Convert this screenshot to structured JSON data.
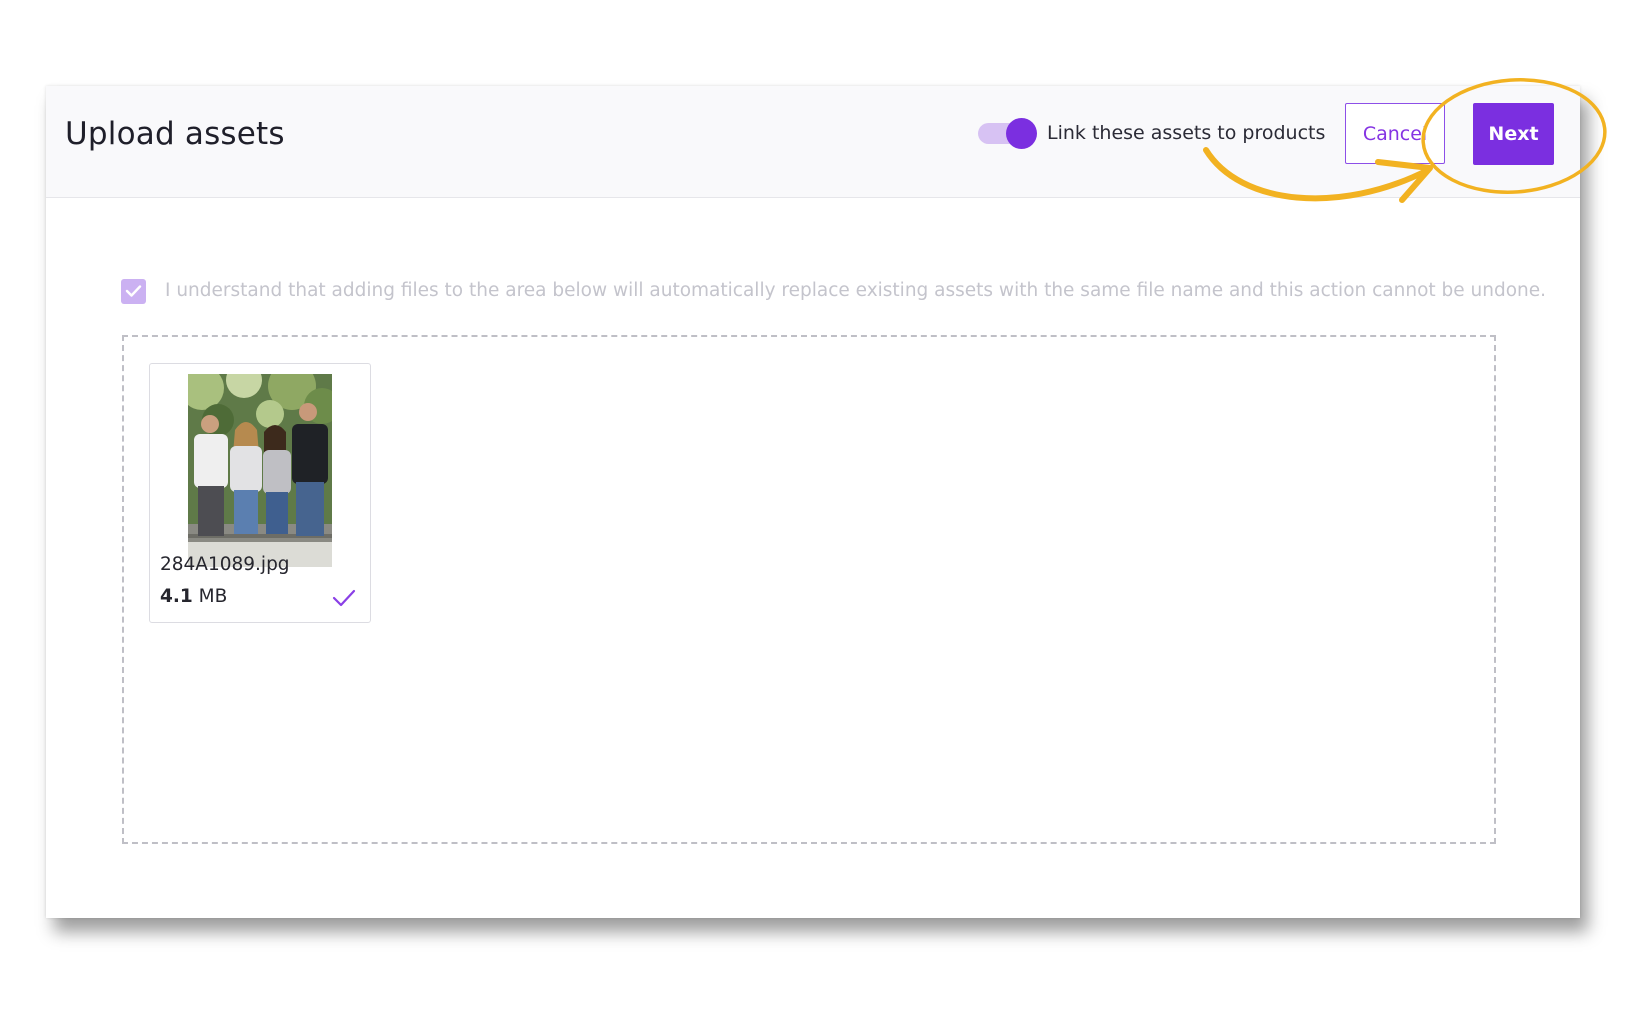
{
  "header": {
    "title": "Upload assets",
    "link_toggle": {
      "label": "Link these assets to products",
      "checked": true
    },
    "cancel_label": "Cancel",
    "next_label": "Next"
  },
  "consent": {
    "checked": true,
    "text": "I understand that adding files to the area below will automatically replace existing assets with the same file name and this action cannot be undone."
  },
  "files": [
    {
      "name": "284A1089.jpg",
      "size_value": "4.1",
      "size_unit": "MB",
      "status": "uploaded"
    }
  ],
  "colors": {
    "accent": "#7b2fe0",
    "accent_light": "#d7c2f3",
    "annotation": "#f2b221"
  },
  "icons": {
    "consent_check": "check-icon",
    "file_status": "check-icon"
  }
}
